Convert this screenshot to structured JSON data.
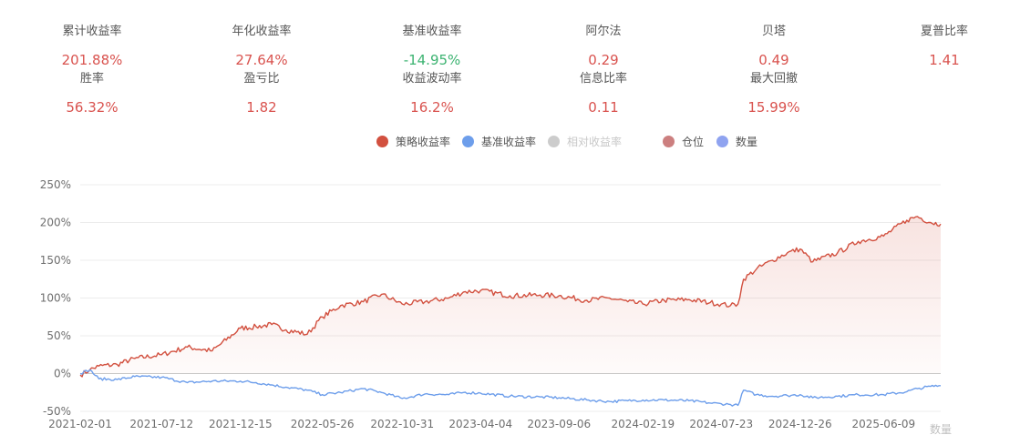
{
  "metrics": [
    {
      "label": "累计收益率",
      "value": "201.88%",
      "color": "#d9534f"
    },
    {
      "label": "年化收益率",
      "value": "27.64%",
      "color": "#d9534f"
    },
    {
      "label": "基准收益率",
      "value": "-14.95%",
      "color": "#3cb371"
    },
    {
      "label": "阿尔法",
      "value": "0.29",
      "color": "#d9534f"
    },
    {
      "label": "贝塔",
      "value": "0.49",
      "color": "#d9534f"
    },
    {
      "label": "夏普比率",
      "value": "1.41",
      "color": "#d9534f"
    },
    {
      "label": "胜率",
      "value": "56.32%",
      "color": "#d9534f"
    },
    {
      "label": "盈亏比",
      "value": "1.82",
      "color": "#d9534f"
    },
    {
      "label": "收益波动率",
      "value": "16.2%",
      "color": "#d9534f"
    },
    {
      "label": "信息比率",
      "value": "0.11",
      "color": "#d9534f"
    },
    {
      "label": "最大回撤",
      "value": "15.99%",
      "color": "#d9534f"
    }
  ],
  "legend": [
    {
      "label": "策略收益率",
      "color": "#d2503f",
      "active": true
    },
    {
      "label": "基准收益率",
      "color": "#6d9eeb",
      "active": true
    },
    {
      "label": "相对收益率",
      "color": "#cccccc",
      "active": false
    },
    {
      "label": "仓位",
      "color": "#cc7f7f",
      "active": true
    },
    {
      "label": "数量",
      "color": "#8fa3f0",
      "active": true
    }
  ],
  "chart_data": {
    "type": "line",
    "x_tick_labels": [
      "2021-02-01",
      "2021-07-12",
      "2021-12-15",
      "2022-05-26",
      "2022-10-31",
      "2023-04-04",
      "2023-09-06",
      "2024-02-19",
      "2024-07-23",
      "2024-12-26",
      "2025-06-09"
    ],
    "y_tick_labels": [
      "250%",
      "200%",
      "150%",
      "100%",
      "50%",
      "0%",
      "-50%"
    ],
    "ylim": [
      -50,
      250
    ],
    "y_unit": "%",
    "secondary_axis_label": "数量",
    "grid": true,
    "legend_position": "top-center",
    "series": [
      {
        "name": "策略收益率",
        "color": "#d2503f",
        "area": true,
        "x": [
          "2021-02-01",
          "2021-02-20",
          "2021-03-10",
          "2021-04-15",
          "2021-05-20",
          "2021-07-12",
          "2021-09-01",
          "2021-10-20",
          "2021-12-15",
          "2022-01-15",
          "2022-02-15",
          "2022-03-15",
          "2022-04-26",
          "2022-05-26",
          "2022-07-01",
          "2022-08-15",
          "2022-09-20",
          "2022-10-31",
          "2022-12-15",
          "2023-01-31",
          "2023-03-01",
          "2023-04-04",
          "2023-06-01",
          "2023-07-31",
          "2023-09-06",
          "2023-10-31",
          "2023-12-15",
          "2024-01-20",
          "2024-02-19",
          "2024-04-01",
          "2024-05-20",
          "2024-07-01",
          "2024-07-23",
          "2024-08-10",
          "2024-08-25",
          "2024-09-05",
          "2024-09-30",
          "2024-11-01",
          "2024-12-01",
          "2024-12-26",
          "2025-01-20",
          "2025-03-10",
          "2025-04-20",
          "2025-06-09",
          "2025-07-25",
          "2025-08-15",
          "2025-09-10",
          "2025-09-30"
        ],
        "values": [
          -2,
          5,
          10,
          12,
          20,
          25,
          35,
          30,
          60,
          62,
          65,
          58,
          52,
          75,
          90,
          95,
          105,
          92,
          95,
          100,
          108,
          110,
          103,
          104,
          103,
          97,
          100,
          95,
          92,
          97,
          98,
          94,
          92,
          90,
          92,
          125,
          138,
          150,
          160,
          165,
          148,
          160,
          175,
          182,
          203,
          208,
          200,
          198
        ]
      },
      {
        "name": "基准收益率",
        "color": "#6d9eeb",
        "area": false,
        "x": [
          "2021-02-01",
          "2021-02-20",
          "2021-03-10",
          "2021-04-15",
          "2021-05-20",
          "2021-07-12",
          "2021-09-01",
          "2021-10-20",
          "2021-12-15",
          "2022-01-15",
          "2022-02-15",
          "2022-03-15",
          "2022-04-26",
          "2022-05-26",
          "2022-07-01",
          "2022-08-15",
          "2022-09-20",
          "2022-10-31",
          "2022-12-15",
          "2023-01-31",
          "2023-03-01",
          "2023-04-04",
          "2023-06-01",
          "2023-07-31",
          "2023-09-06",
          "2023-10-31",
          "2023-12-15",
          "2024-01-20",
          "2024-02-19",
          "2024-04-01",
          "2024-05-20",
          "2024-07-01",
          "2024-07-23",
          "2024-08-10",
          "2024-08-25",
          "2024-09-05",
          "2024-09-30",
          "2024-11-01",
          "2024-12-01",
          "2024-12-26",
          "2025-01-20",
          "2025-03-10",
          "2025-04-20",
          "2025-06-09",
          "2025-07-25",
          "2025-08-15",
          "2025-09-10",
          "2025-09-30"
        ],
        "values": [
          0,
          5,
          -7,
          -8,
          -4,
          -5,
          -12,
          -10,
          -10,
          -12,
          -15,
          -18,
          -22,
          -28,
          -25,
          -20,
          -25,
          -33,
          -27,
          -28,
          -25,
          -26,
          -30,
          -31,
          -32,
          -35,
          -37,
          -36,
          -35,
          -35,
          -36,
          -39,
          -40,
          -41,
          -42,
          -22,
          -28,
          -30,
          -29,
          -28,
          -32,
          -30,
          -28,
          -28,
          -24,
          -20,
          -17,
          -16
        ]
      }
    ]
  }
}
